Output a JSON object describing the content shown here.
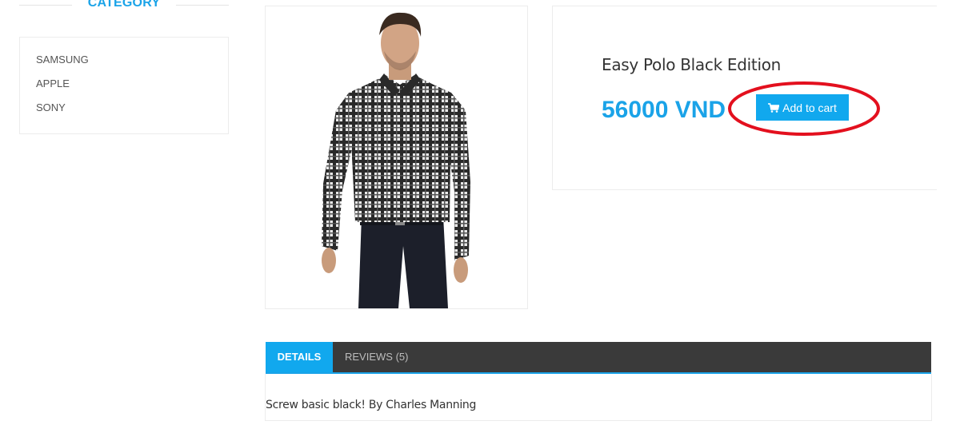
{
  "sidebar": {
    "title": "CATEGORY",
    "items": [
      {
        "label": "SAMSUNG"
      },
      {
        "label": "APPLE"
      },
      {
        "label": "SONY"
      }
    ]
  },
  "product": {
    "name": "Easy Polo Black Edition",
    "price": "56000 VND",
    "add_to_cart_label": "Add to cart",
    "image_alt": "model wearing checkered shirt"
  },
  "tabs": [
    {
      "label": "DETAILS",
      "active": true
    },
    {
      "label": "REVIEWS (5)",
      "active": false
    }
  ],
  "details": {
    "text": "Screw basic black! By Charles Manning"
  },
  "colors": {
    "accent": "#1aa3e8",
    "button": "#11a8ee",
    "tab_bar": "#3a3a3a",
    "annotation": "#e3101e"
  },
  "icons": {
    "cart": "shopping-cart-icon"
  }
}
